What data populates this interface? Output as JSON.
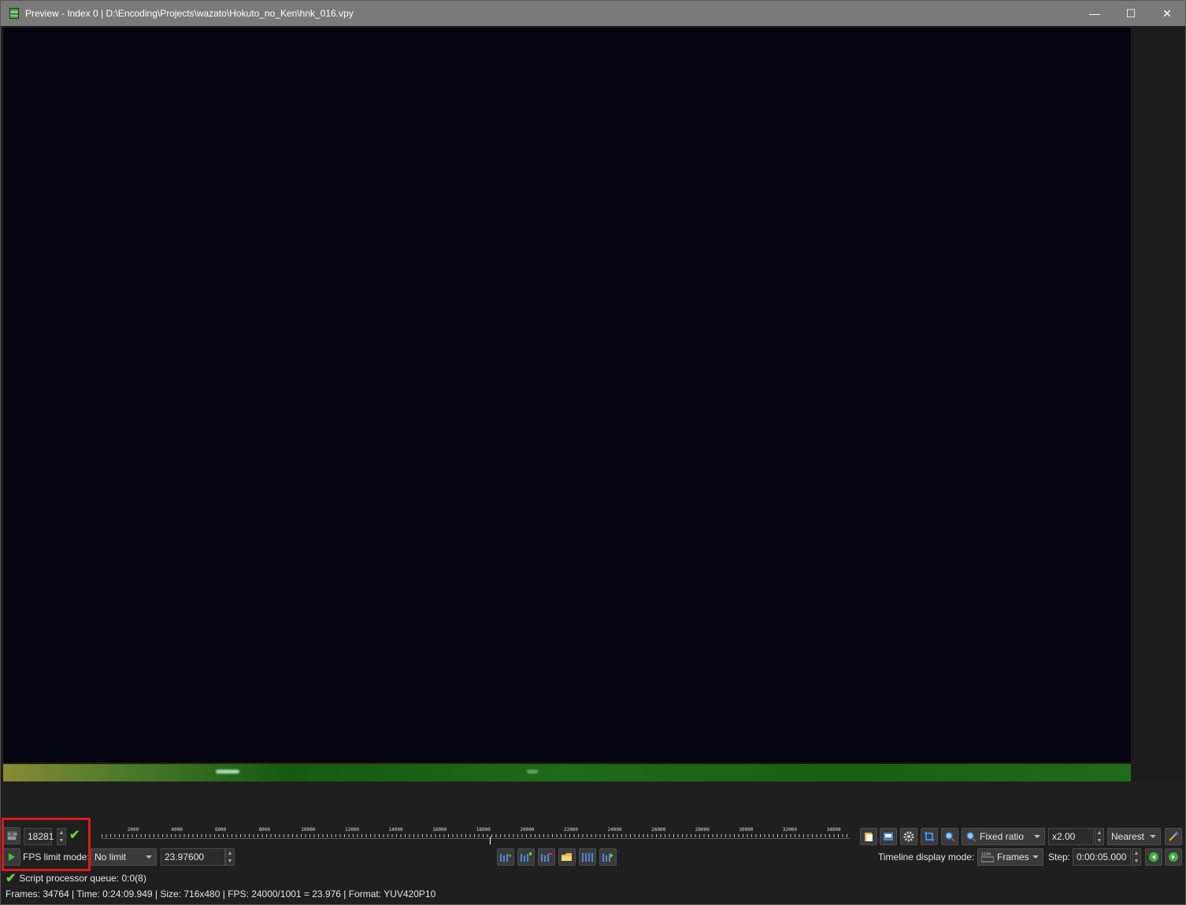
{
  "window": {
    "title": "Preview - Index 0 | D:\\Encoding\\Projects\\wazato\\Hokuto_no_Ken\\hnk_016.vpy",
    "minimize_glyph": "—",
    "maximize_glyph": "☐",
    "close_glyph": "✕"
  },
  "frame_controls": {
    "frame_value": "18281",
    "frame_icon": "frame-counter-icon",
    "confirm_icon": "checkmark-icon"
  },
  "timeline": {
    "tick_labels": [
      "2000",
      "4000",
      "6000",
      "8000",
      "10000",
      "12000",
      "14000",
      "16000",
      "18000",
      "20000",
      "22000",
      "24000",
      "26000",
      "28000",
      "30000",
      "32000",
      "34000"
    ],
    "max_frames": 34764,
    "current_frame": 18281
  },
  "zoom_toolbar": {
    "icons": [
      "copy-frame-icon",
      "save-snapshot-icon",
      "settings-gear-icon",
      "crop-icon",
      "zoom-icon"
    ],
    "zoom_mode": "Fixed ratio",
    "zoom_ratio": "x2.00",
    "scale_mode": "Nearest",
    "picker_icon": "color-picker-icon"
  },
  "playback": {
    "play_icon": "play-icon",
    "fps_limit_label": "FPS limit mode:",
    "fps_limit_value": "No limit",
    "fps_value": "23.97600"
  },
  "bookmarks_toolbar": {
    "icons": [
      "bookmark-add-icon",
      "bookmark-list-icon",
      "bookmark-remove-icon",
      "folder-open-icon",
      "bookmarks-icon",
      "bookmark-next-icon"
    ]
  },
  "timeline_mode": {
    "label": "Timeline display mode:",
    "value": "Frames",
    "step_label": "Step:",
    "step_value": "0:00:05.000"
  },
  "status": {
    "queue_text": "Script processor queue: 0:0(8)",
    "info_text": "Frames: 34764 | Time: 0:24:09.949 | Size: 716x480 | FPS: 24000/1001 = 23.976 | Format: YUV420P10"
  },
  "colors": {
    "accent_check": "#6cd12a",
    "highlight_box": "#e01818",
    "titlebar": "#7a7a7a"
  }
}
